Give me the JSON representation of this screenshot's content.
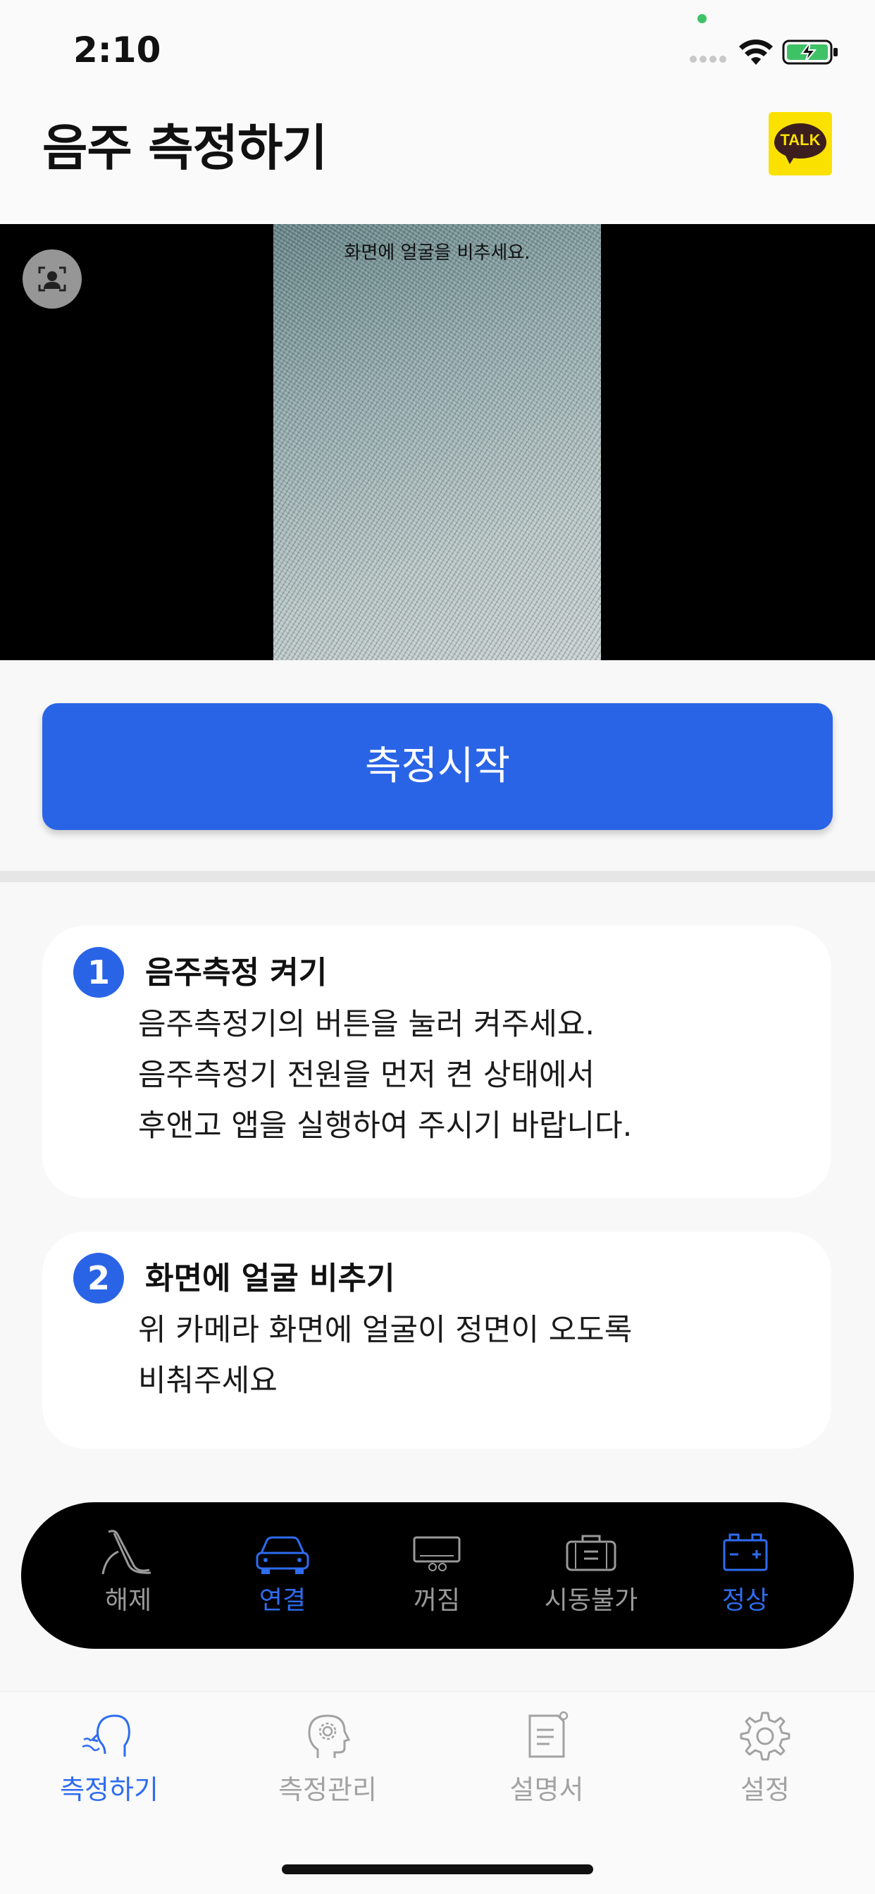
{
  "status_bar": {
    "time": "2:10",
    "icons": [
      "signal-dots-icon",
      "wifi-icon",
      "battery-charging-icon"
    ]
  },
  "header": {
    "title": "음주 측정하기",
    "kakao_label": "TALK"
  },
  "camera": {
    "hint": "화면에 얼굴을 비추세요.",
    "switch_icon": "face-frame-icon"
  },
  "start_button_label": "측정시작",
  "steps": [
    {
      "number": "1",
      "title": "음주측정 켜기",
      "lines": [
        "음주측정기의 버튼을 눌러 켜주세요.",
        "음주측정기 전원을 먼저 켠 상태에서",
        "후앤고 앱을 실행하여 주시기 바랍니다."
      ]
    },
    {
      "number": "2",
      "title": "화면에 얼굴 비추기",
      "lines": [
        "위 카메라 화면에 얼굴이 정면이 오도록",
        "비춰주세요"
      ]
    }
  ],
  "status_panel": {
    "items": [
      {
        "label": "해제",
        "icon": "seatbelt-icon",
        "active": false
      },
      {
        "label": "연결",
        "icon": "car-icon",
        "active": true
      },
      {
        "label": "꺼짐",
        "icon": "device-off-icon",
        "active": false
      },
      {
        "label": "시동불가",
        "icon": "engine-locked-icon",
        "active": false
      },
      {
        "label": "정상",
        "icon": "battery-ok-icon",
        "active": true
      }
    ],
    "colors": {
      "active": "#2e6cf0",
      "inactive": "#9a9a9a"
    }
  },
  "tab_bar": {
    "tabs": [
      {
        "label": "측정하기",
        "icon": "breath-face-icon",
        "active": true
      },
      {
        "label": "측정관리",
        "icon": "head-gear-icon",
        "active": false
      },
      {
        "label": "설명서",
        "icon": "document-icon",
        "active": false
      },
      {
        "label": "설정",
        "icon": "gear-icon",
        "active": false
      }
    ]
  },
  "colors": {
    "accent": "#2a64e6",
    "kakao_yellow": "#fae100"
  }
}
